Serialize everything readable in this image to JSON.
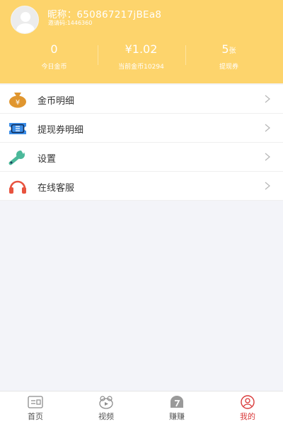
{
  "profile": {
    "nickname": "昵称：650867217jBEa8",
    "invite_code": "邀请码:1446360"
  },
  "stats": [
    {
      "value": "0",
      "unit": "",
      "caption": "今日金币"
    },
    {
      "value": "¥1.02",
      "unit": "",
      "caption": "当前金币10294"
    },
    {
      "value": "5",
      "unit": "张",
      "caption": "提现券"
    }
  ],
  "menu": {
    "items": [
      {
        "label": "金币明细",
        "icon": "coin-bag-icon"
      },
      {
        "label": "提现券明细",
        "icon": "ticket-icon"
      },
      {
        "label": "设置",
        "icon": "wrench-icon"
      },
      {
        "label": "在线客服",
        "icon": "headset-icon"
      }
    ]
  },
  "tabs": [
    {
      "label": "首页",
      "icon": "home-icon",
      "active": false
    },
    {
      "label": "视频",
      "icon": "video-icon",
      "active": false
    },
    {
      "label": "赚赚",
      "icon": "earn-icon",
      "active": false
    },
    {
      "label": "我的",
      "icon": "profile-icon",
      "active": true
    }
  ],
  "colors": {
    "header_bg": "#fdd46c",
    "page_bg": "#f3f4f9",
    "active_tab": "#d93a3a",
    "coin_icon": "#e0962f",
    "ticket_icon": "#3b8ee8",
    "wrench_icon": "#4bb99a",
    "headset_icon": "#e8533f"
  }
}
